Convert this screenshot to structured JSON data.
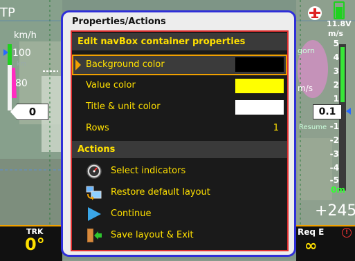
{
  "background": {
    "top_left_label": "TP",
    "speed_unit": "km/h",
    "speed_upper": "100",
    "speed_unit_small": "km",
    "speed_lower": "80",
    "altitude_box": "0",
    "battery_voltage": "11.8V",
    "vario_unit": "m/s",
    "vario_ticks": [
      "5",
      "4",
      "3",
      "2",
      "1",
      "-1",
      "-2",
      "-3",
      "-4",
      "-5"
    ],
    "vario_value": "0.1",
    "vario_zero": "0m",
    "map_label_gorn": "gorn",
    "map_unit_ms": "m/s",
    "map_label_resume": "Resume",
    "altitude_readout": "+245"
  },
  "bottom": {
    "trk_label": "TRK",
    "trk_value": "0°",
    "req_label": "Req E",
    "req_value": "∞",
    "warn": "!"
  },
  "dialog": {
    "title": "Properties/Actions",
    "section_edit": "Edit navBox container properties",
    "properties": [
      {
        "label": "Background color",
        "swatch": "#000000",
        "selected": true
      },
      {
        "label": "Value color",
        "swatch": "#ffff00"
      },
      {
        "label": "Title & unit color",
        "swatch": "#ffffff"
      }
    ],
    "rows_label": "Rows",
    "rows_value": "1",
    "section_actions": "Actions",
    "actions": [
      {
        "label": "Select indicators",
        "icon": "gauge-icon"
      },
      {
        "label": "Restore default layout",
        "icon": "restore-layout-icon"
      },
      {
        "label": "Continue",
        "icon": "play-icon"
      },
      {
        "label": "Save layout & Exit",
        "icon": "exit-door-icon"
      }
    ]
  },
  "colors": {
    "accent_yellow": "#ffe000",
    "dialog_border": "#2f2fd8",
    "selection_orange": "#f0a000",
    "body_border_red": "#e03030"
  }
}
